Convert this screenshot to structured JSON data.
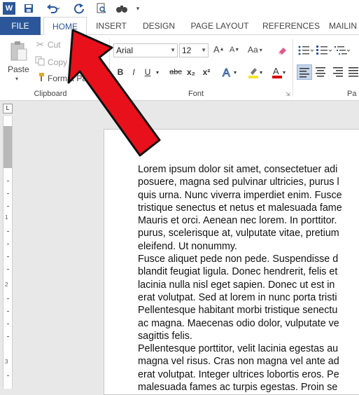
{
  "qat": {
    "icons": [
      "word-logo-icon",
      "save-icon",
      "undo-icon",
      "redo-icon",
      "print-preview-icon",
      "find-icon",
      "customize-icon"
    ]
  },
  "tabs": [
    "FILE",
    "HOME",
    "INSERT",
    "DESIGN",
    "PAGE LAYOUT",
    "REFERENCES",
    "MAILIN"
  ],
  "ribbon": {
    "clipboard": {
      "paste": "Paste",
      "cut": "Cut",
      "copy": "Copy",
      "format_painter": "Format Painter",
      "label": "Clipboard"
    },
    "font": {
      "name": "Arial",
      "size": "12",
      "bold": "B",
      "italic": "I",
      "underline": "U",
      "strike": "abc",
      "subscript": "x₂",
      "superscript": "x²",
      "grow": "A",
      "shrink": "A",
      "case": "Aa",
      "label": "Font"
    },
    "paragraph": {
      "label": "Pa"
    }
  },
  "ruler": {
    "tab_stop": "L",
    "numbers": [
      "1",
      "2",
      "3"
    ]
  },
  "document": {
    "lines": [
      "Lorem ipsum dolor sit amet, consectetuer adi",
      "posuere, magna sed pulvinar ultricies, purus l",
      "quis urna. Nunc viverra imperdiet enim. Fusce",
      "tristique senectus et netus et malesuada fame",
      "Mauris et orci. Aenean nec lorem. In porttitor.",
      "purus, scelerisque at, vulputate vitae, pretium",
      "eleifend. Ut nonummy.",
      "Fusce aliquet pede non pede. Suspendisse d",
      "blandit feugiat ligula. Donec hendrerit, felis et",
      "lacinia nulla nisl eget sapien. Donec ut est in",
      "erat volutpat. Sed at lorem in nunc porta tristi",
      "Pellentesque habitant morbi tristique senectu",
      "ac magna. Maecenas odio dolor, vulputate ve",
      "sagittis felis.",
      "Pellentesque porttitor, velit lacinia egestas au",
      "magna vel risus. Cras non magna vel ante ad",
      "erat volutpat. Integer ultrices lobortis eros. Pe",
      "malesuada fames ac turpis egestas. Proin se"
    ]
  },
  "colors": {
    "accent": "#2b579a",
    "arrow_fill": "#e8101a",
    "highlight": "#f5e52a",
    "font_color": "#d40000"
  }
}
